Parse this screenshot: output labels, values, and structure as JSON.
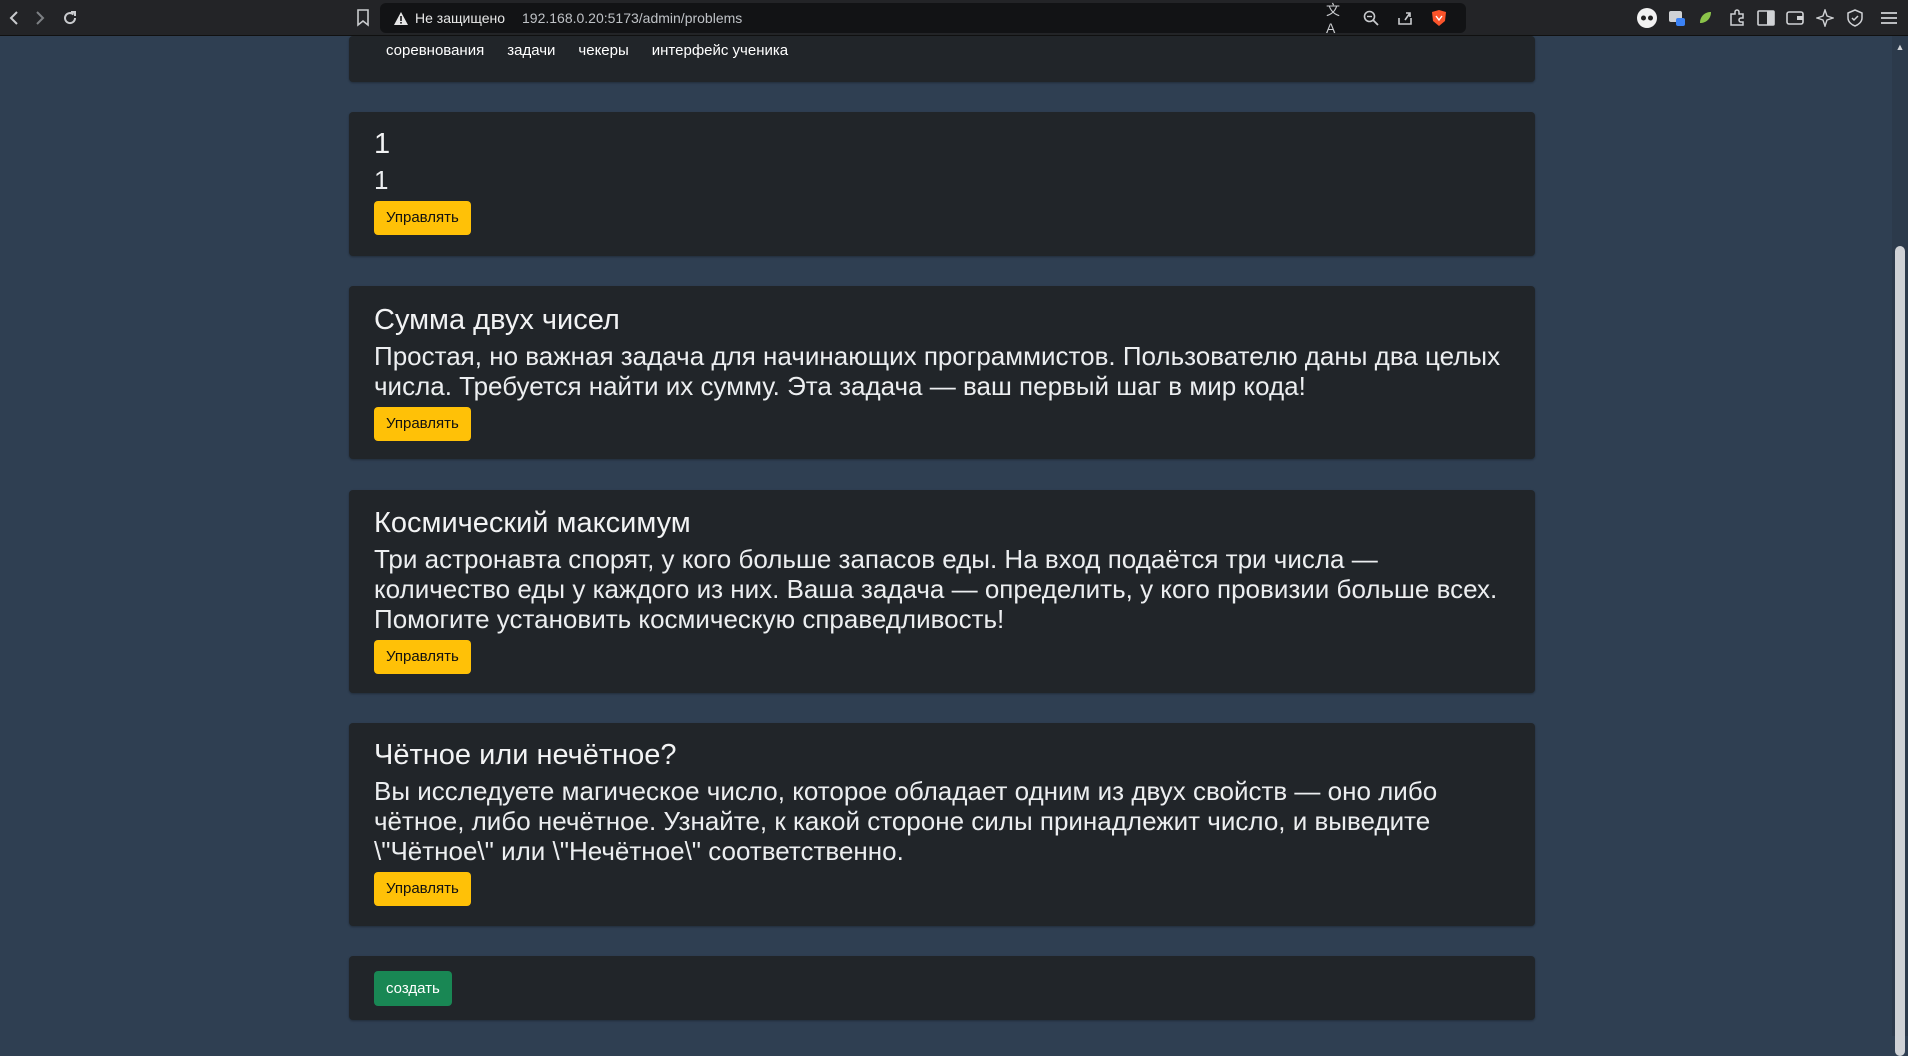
{
  "browser": {
    "security_label": "Не защищено",
    "url": "192.168.0.20:5173/admin/problems"
  },
  "nav": {
    "links": [
      "соревнования",
      "задачи",
      "чекеры",
      "интерфейс ученика"
    ]
  },
  "problems": [
    {
      "title": "1",
      "description": "1",
      "button": "Управлять"
    },
    {
      "title": "Сумма двух чисел",
      "description": "Простая, но важная задача для начинающих программистов. Пользователю даны два целых числа. Требуется найти их сумму. Эта задача — ваш первый шаг в мир кода!",
      "button": "Управлять"
    },
    {
      "title": "Космический максимум",
      "description": "Три астронавта спорят, у кого больше запасов еды. На вход подаётся три числа — количество еды у каждого из них. Ваша задача — определить, у кого провизии больше всех. Помогите установить космическую справедливость!",
      "button": "Управлять"
    },
    {
      "title": "Чётное или нечётное?",
      "description": "Вы исследуете магическое число, которое обладает одним из двух свойств — оно либо чётное, либо нечётное. Узнайте, к какой стороне силы принадлежит число, и выведите \\\"Чётное\\\" или \\\"Нечётное\\\" соответственно.",
      "button": "Управлять"
    }
  ],
  "create_button": "создать",
  "colors": {
    "page_bg": "#2f3f52",
    "card_bg": "#212529",
    "manage_button": "#ffc107",
    "create_button": "#198754"
  },
  "icons": {
    "back": "arrow-left-icon",
    "forward": "arrow-right-icon",
    "reload": "reload-icon",
    "bookmark": "bookmark-icon",
    "warning": "warning-icon",
    "translate": "translate-icon",
    "zoom": "zoom-icon",
    "share": "share-icon",
    "brave": "brave-shield-icon",
    "menu": "hamburger-menu-icon"
  }
}
